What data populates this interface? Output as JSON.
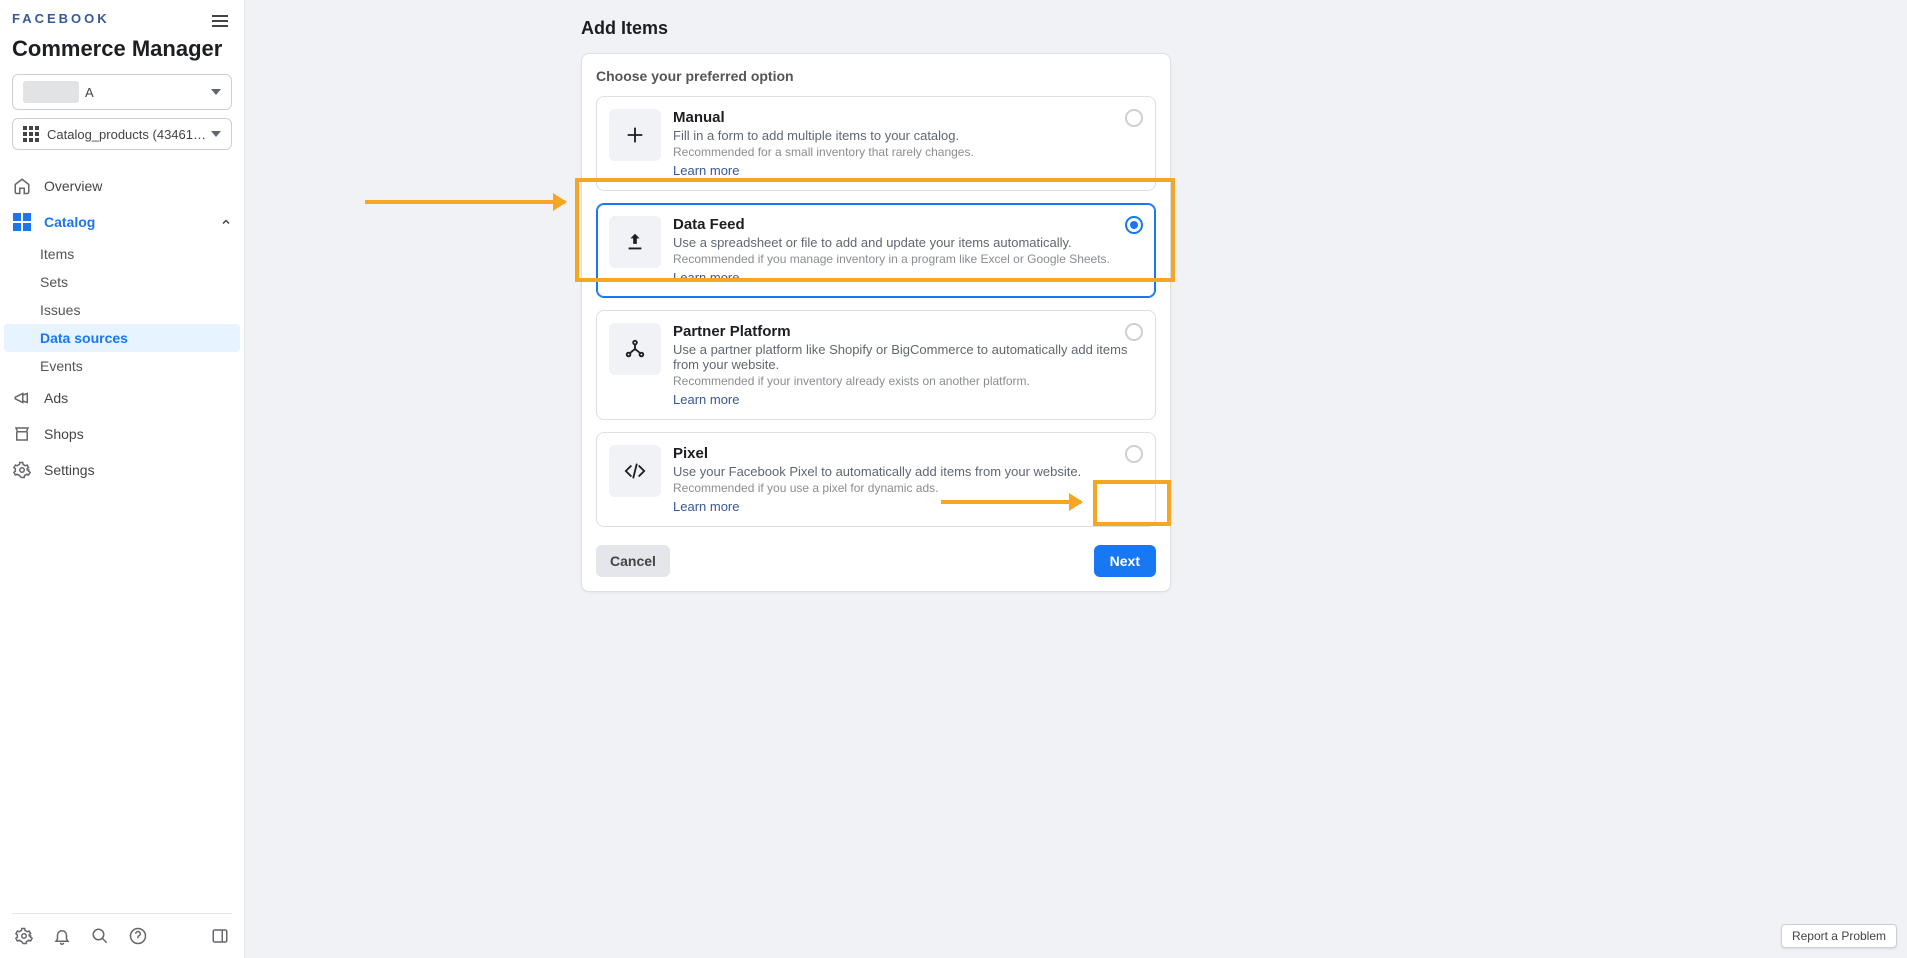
{
  "brand": "FACEBOOK",
  "app_title": "Commerce Manager",
  "account_selector": {
    "label": "A"
  },
  "catalog_selector": {
    "label": "Catalog_products (43461994…"
  },
  "nav": {
    "overview": "Overview",
    "catalog": "Catalog",
    "catalog_children": {
      "items": "Items",
      "sets": "Sets",
      "issues": "Issues",
      "data_sources": "Data sources",
      "events": "Events"
    },
    "ads": "Ads",
    "shops": "Shops",
    "settings": "Settings"
  },
  "page_title": "Add Items",
  "card_heading": "Choose your preferred option",
  "options": {
    "manual": {
      "title": "Manual",
      "desc": "Fill in a form to add multiple items to your catalog.",
      "reco": "Recommended for a small inventory that rarely changes.",
      "learn": "Learn more"
    },
    "data_feed": {
      "title": "Data Feed",
      "desc": "Use a spreadsheet or file to add and update your items automatically.",
      "reco": "Recommended if you manage inventory in a program like Excel or Google Sheets.",
      "learn": "Learn more"
    },
    "partner": {
      "title": "Partner Platform",
      "desc": "Use a partner platform like Shopify or BigCommerce to automatically add items from your website.",
      "reco": "Recommended if your inventory already exists on another platform.",
      "learn": "Learn more"
    },
    "pixel": {
      "title": "Pixel",
      "desc": "Use your Facebook Pixel to automatically add items from your website.",
      "reco": "Recommended if you use a pixel for dynamic ads.",
      "learn": "Learn more"
    }
  },
  "buttons": {
    "cancel": "Cancel",
    "next": "Next"
  },
  "report_problem": "Report a Problem"
}
